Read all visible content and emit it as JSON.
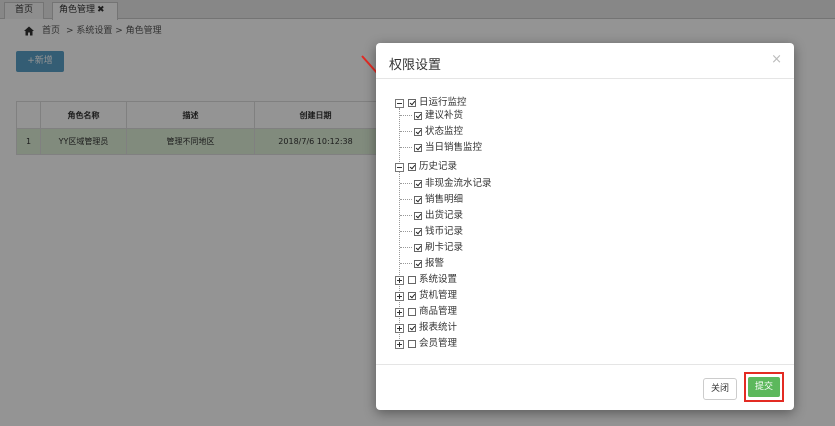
{
  "tabs": [
    {
      "label": "首页"
    },
    {
      "label": "角色管理",
      "close": "✖"
    }
  ],
  "breadcrumb": {
    "home": "首页",
    "path": "> 系统设置 > 角色管理"
  },
  "toolbar": {
    "add_label": "+新增"
  },
  "table": {
    "columns": [
      "",
      "角色名称",
      "描述",
      "创建日期"
    ],
    "rows": [
      {
        "index": "1",
        "name": "YY区域管理员",
        "desc": "管理不同地区",
        "date": "2018/7/6 10:12:38"
      }
    ]
  },
  "modal": {
    "title": "权限设置",
    "close_icon": "×",
    "tree": [
      {
        "label": "日运行监控",
        "checked": true,
        "expanded": true,
        "children": [
          {
            "label": "建议补货",
            "checked": true
          },
          {
            "label": "状态监控",
            "checked": true
          },
          {
            "label": "当日销售监控",
            "checked": true
          }
        ]
      },
      {
        "label": "历史记录",
        "checked": true,
        "expanded": true,
        "children": [
          {
            "label": "非现金流水记录",
            "checked": true
          },
          {
            "label": "销售明细",
            "checked": true
          },
          {
            "label": "出货记录",
            "checked": true
          },
          {
            "label": "钱币记录",
            "checked": true
          },
          {
            "label": "刷卡记录",
            "checked": true
          },
          {
            "label": "报警",
            "checked": true
          }
        ]
      },
      {
        "label": "系统设置",
        "checked": false,
        "expanded": false
      },
      {
        "label": "货机管理",
        "checked": true,
        "expanded": false
      },
      {
        "label": "商品管理",
        "checked": false,
        "expanded": false
      },
      {
        "label": "报表统计",
        "checked": true,
        "expanded": false
      },
      {
        "label": "会员管理",
        "checked": false,
        "expanded": false
      }
    ],
    "buttons": {
      "close": "关闭",
      "submit": "提交"
    }
  },
  "colors": {
    "accent": "#5ba1c9",
    "submit": "#5cb85c",
    "highlight": "#e32b23",
    "selected_row": "#dff0d8"
  }
}
